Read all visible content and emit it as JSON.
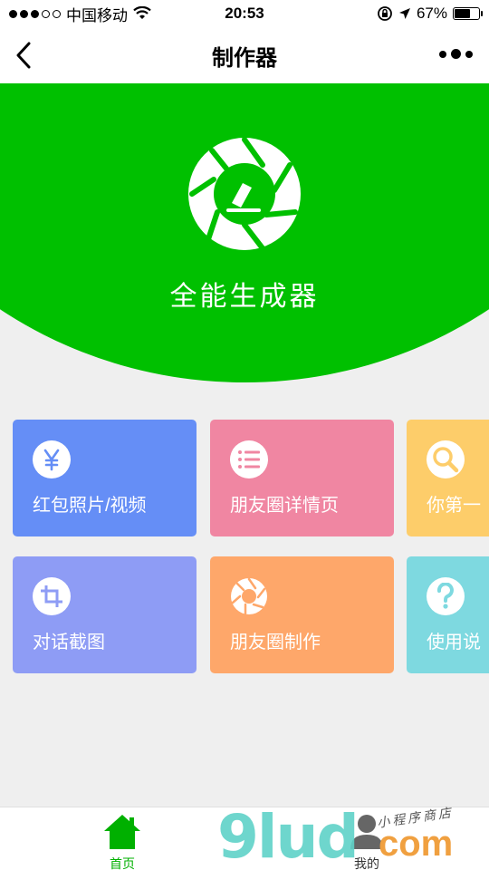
{
  "status_bar": {
    "carrier": "中国移动",
    "time": "20:53",
    "battery": "67%",
    "battery_level": 0.67
  },
  "nav": {
    "title": "制作器"
  },
  "hero": {
    "title": "全能生成器",
    "color": "#00c000"
  },
  "cards": [
    {
      "label": "红包照片/视频",
      "icon": "yuan-icon",
      "color": "#658ef6"
    },
    {
      "label": "朋友圈详情页",
      "icon": "list-icon",
      "color": "#f086a2"
    },
    {
      "label": "你第一",
      "icon": "search-icon",
      "color": "#fdcd6a"
    },
    {
      "label": "对话截图",
      "icon": "crop-icon",
      "color": "#8e9cf5"
    },
    {
      "label": "朋友圈制作",
      "icon": "aperture-icon",
      "color": "#fea76a"
    },
    {
      "label": "使用说",
      "icon": "help-icon",
      "color": "#7ed9e0"
    }
  ],
  "tabbar": {
    "home_label": "首页",
    "mine_label": "我的",
    "active_color": "#00b000"
  },
  "watermark": {
    "text": "9lud",
    "com": "com",
    "small": "小程序商店"
  }
}
